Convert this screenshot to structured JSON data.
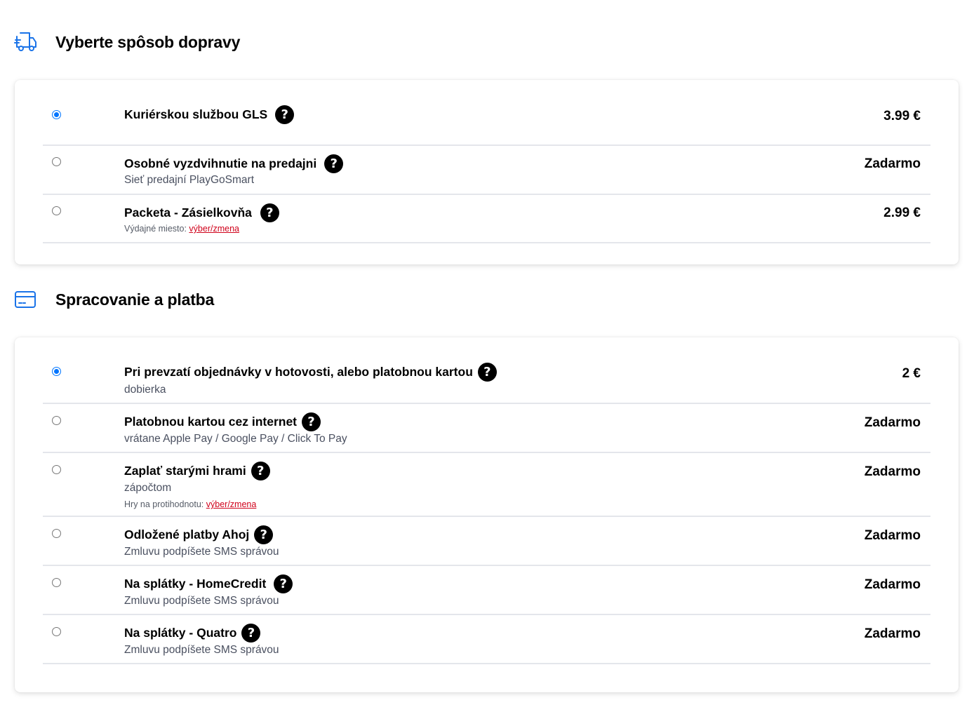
{
  "shipping": {
    "title": "Vyberte spôsob dopravy",
    "icon": "truck-icon",
    "accent": "#1a73e8",
    "options": [
      {
        "label": "Kuriérskou službou GLS",
        "price": "3.99 €",
        "selected": true
      },
      {
        "label": "Osobné vyzdvihnutie na predajni",
        "sub": "Sieť predajní PlayGoSmart",
        "price": "Zadarmo",
        "selected": false
      },
      {
        "label": "Packeta - Zásielkovňa",
        "note_label": "Výdajné miesto:",
        "note_link": "výber/zmena",
        "price": "2.99 €",
        "selected": false
      }
    ]
  },
  "payment": {
    "title": "Spracovanie a platba",
    "icon": "credit-card-icon",
    "options": [
      {
        "label": "Pri prevzatí objednávky v hotovosti, alebo platobnou kartou",
        "sub": "dobierka",
        "price": "2 €",
        "selected": true
      },
      {
        "label": "Platobnou kartou cez internet",
        "sub": "vrátane Apple Pay / Google Pay / Click To Pay",
        "price": "Zadarmo",
        "selected": false
      },
      {
        "label": "Zaplať starými hrami",
        "sub": "zápočtom",
        "note_label": "Hry na protihodnotu:",
        "note_link": "výber/zmena",
        "price": "Zadarmo",
        "selected": false
      },
      {
        "label": "Odložené platby Ahoj",
        "sub": "Zmluvu podpíšete SMS správou",
        "price": "Zadarmo",
        "selected": false
      },
      {
        "label": "Na splátky - HomeCredit",
        "sub": "Zmluvu podpíšete SMS správou",
        "price": "Zadarmo",
        "selected": false
      },
      {
        "label": "Na splátky - Quatro",
        "sub": "Zmluvu podpíšete SMS správou",
        "price": "Zadarmo",
        "selected": false
      }
    ]
  },
  "help_glyph": "?",
  "colors": {
    "radio_checked": "#0075ff",
    "link": "#d0021b",
    "divider": "#e4e6eb"
  }
}
